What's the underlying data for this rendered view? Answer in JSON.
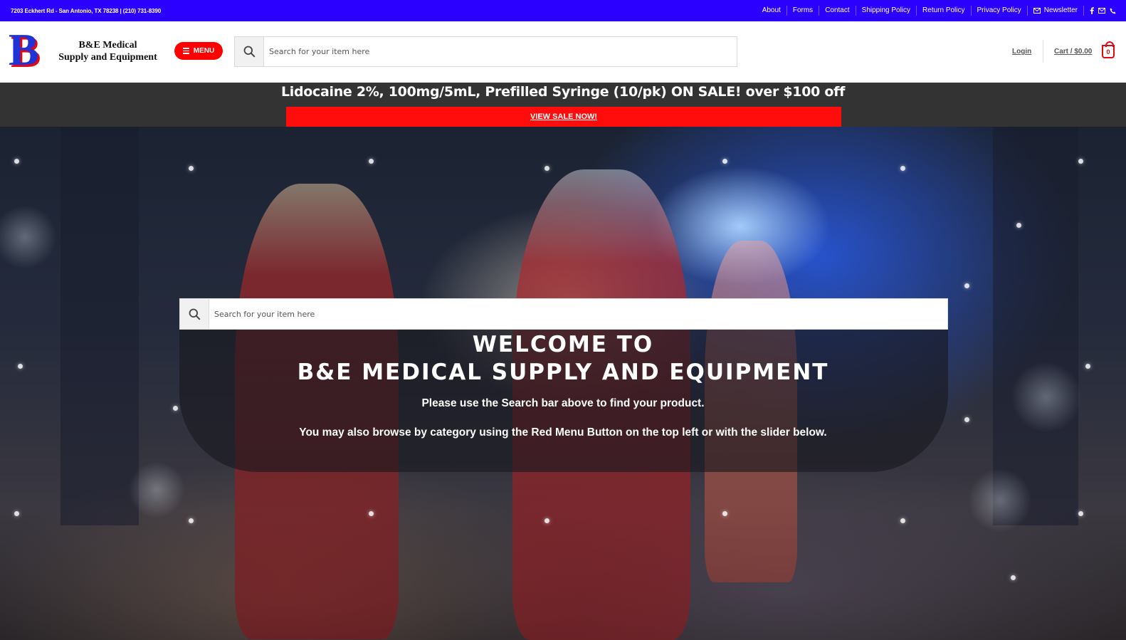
{
  "topbar": {
    "address": "7203 Eckhert Rd - San Antonio, TX 78238 | (210) 731-8390",
    "links": [
      "About",
      "Forms",
      "Contact",
      "Shipping Policy",
      "Return Policy",
      "Privacy Policy"
    ],
    "newsletter": "Newsletter",
    "icons": [
      "facebook-icon",
      "envelope-icon",
      "phone-icon"
    ]
  },
  "header": {
    "logo_letter": "B",
    "logo_line1": "B&E Medical",
    "logo_line2": "Supply and Equipment",
    "menu_label": "MENU",
    "search_placeholder": "Search for your item here",
    "login_label": "Login",
    "cart_label": "Cart / $0.00",
    "cart_count": "0"
  },
  "promo": {
    "title": "Lidocaine 2%, 100mg/5mL, Prefilled Syringe (10/pk) ON SALE! over $100 off",
    "button_label": "VIEW SALE NOW!"
  },
  "hero": {
    "search_placeholder": "Search for your item here",
    "welcome_line1": "WELCOME TO",
    "welcome_line2": "B&E MEDICAL SUPPLY AND EQUIPMENT",
    "sub1": "Please use the Search bar above to find your product.",
    "sub2": "You may also browse by category using the Red Menu Button on the top left or with the slider below."
  },
  "colors": {
    "topbar_bg": "#2b00ff",
    "accent_red": "#ff0000",
    "promo_bg": "#333333",
    "logo_blue": "#1f33d6"
  }
}
